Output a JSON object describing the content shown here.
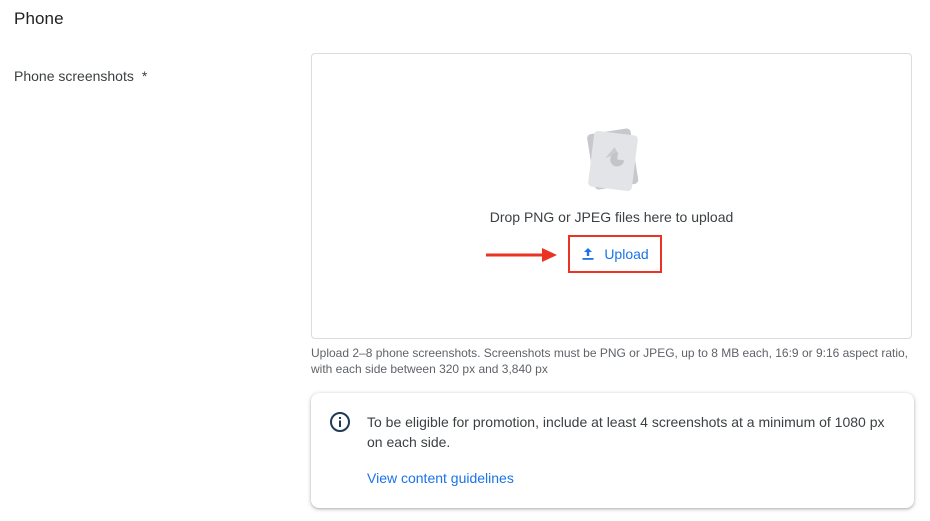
{
  "section": {
    "title": "Phone"
  },
  "field": {
    "label": "Phone screenshots",
    "required_marker": "*"
  },
  "dropzone": {
    "drop_text": "Drop PNG or JPEG files here to upload",
    "upload_label": "Upload",
    "icon": "image-file-icon"
  },
  "helper": {
    "text": "Upload 2–8 phone screenshots. Screenshots must be PNG or JPEG, up to 8 MB each, 16:9 or 9:16 aspect ratio, with each side between 320 px and 3,840 px"
  },
  "info_card": {
    "icon": "info-icon",
    "text": "To be eligible for promotion, include at least 4 screenshots at a minimum of 1080 px on each side.",
    "link_label": "View content guidelines"
  },
  "colors": {
    "accent": "#1a73e8",
    "annotation_red": "#ea3323",
    "border": "#dadce0",
    "text_primary": "#202124",
    "text_secondary": "#5f6368"
  }
}
